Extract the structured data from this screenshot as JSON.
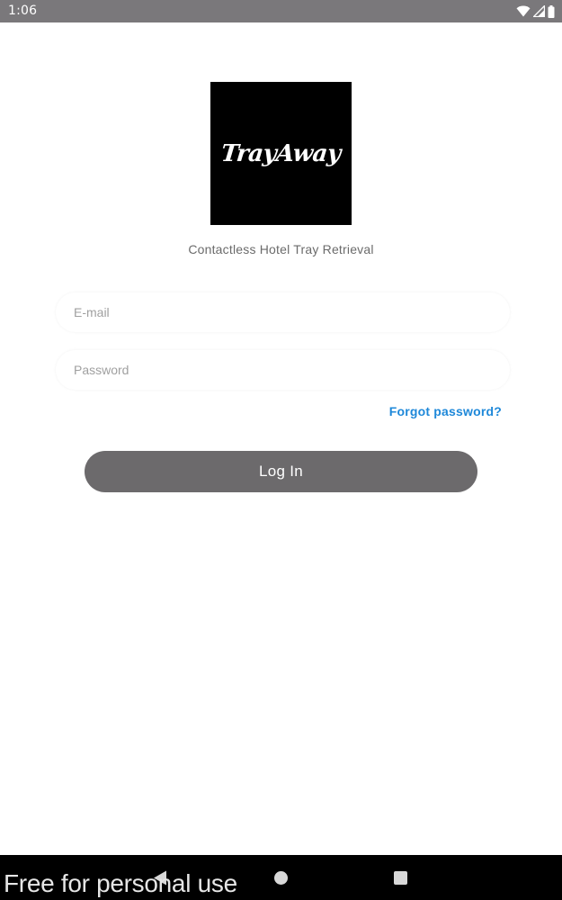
{
  "status_bar": {
    "time": "1:06",
    "icons": [
      "wifi-icon",
      "signal-icon",
      "battery-icon"
    ]
  },
  "logo": {
    "text": "TrayAway"
  },
  "tagline": "Contactless Hotel Tray Retrieval",
  "login_form": {
    "email": {
      "value": "",
      "placeholder": "E-mail"
    },
    "password": {
      "value": "",
      "placeholder": "Password"
    },
    "forgot_password_label": "Forgot password?",
    "login_label": "Log In"
  },
  "nav_bar": {
    "buttons": [
      "back-icon",
      "home-icon",
      "recents-icon"
    ]
  },
  "watermark": "Free for personal use",
  "colors": {
    "status_bar": "#7a787b",
    "link": "#1e88d9",
    "login_button": "#6c6a6c",
    "logo_bg": "#000000"
  }
}
